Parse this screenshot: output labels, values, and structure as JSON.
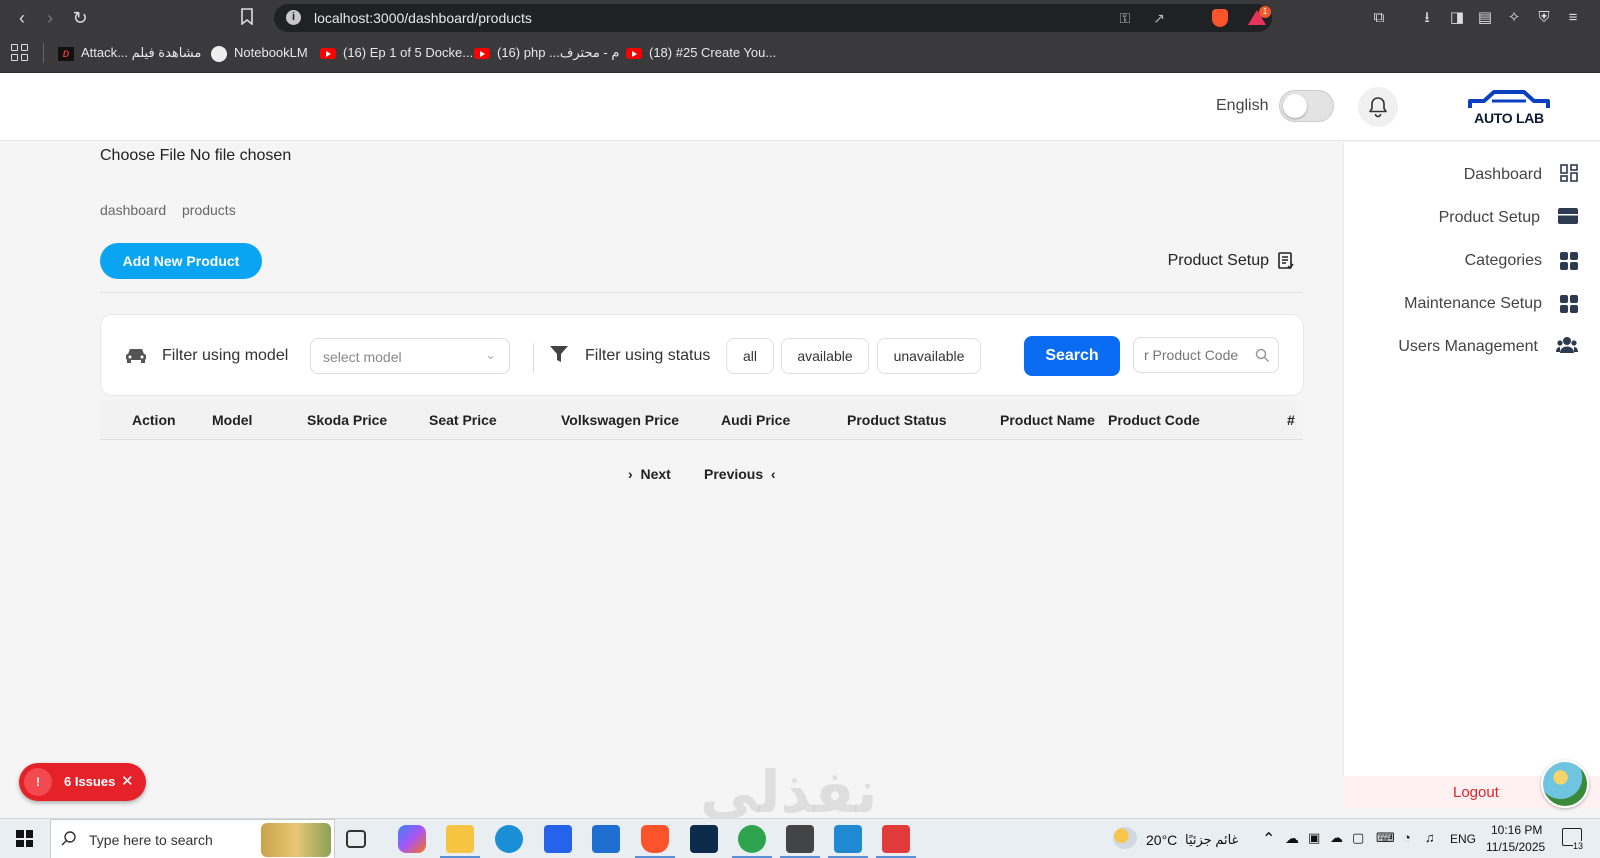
{
  "browser": {
    "url": "localhost:3000/dashboard/products",
    "bookmarks": [
      "Attack... مشاهدة فيلم",
      "NotebookLM",
      "(16) Ep 1 of 5 Docke...",
      "(16) php ...م - محترف",
      "(18) #25 Create You..."
    ],
    "extension_badge": "1"
  },
  "header": {
    "language_label": "English",
    "logo_text": "AUTO LAB"
  },
  "sidebar": {
    "items": [
      {
        "label": "Dashboard",
        "icon": "dashboard-icon"
      },
      {
        "label": "Product Setup",
        "icon": "box-icon"
      },
      {
        "label": "Categories",
        "icon": "grid-icon"
      },
      {
        "label": "Maintenance Setup",
        "icon": "grid-icon"
      },
      {
        "label": "Users Management",
        "icon": "users-icon"
      }
    ],
    "logout_label": "Logout"
  },
  "main": {
    "file_input_text": "Choose File No file chosen",
    "breadcrumb": [
      "dashboard",
      "products"
    ],
    "add_button_label": "Add New Product",
    "page_title": "Product Setup",
    "filter": {
      "model_label": "Filter using model",
      "model_placeholder": "select model",
      "status_label": "Filter using status",
      "status_options": [
        "all",
        "available",
        "unavailable"
      ],
      "search_label": "Search",
      "code_placeholder": "r Product Code"
    },
    "table_headers": [
      "Action",
      "Model",
      "Skoda Price",
      "Seat Price",
      "Volkswagen Price",
      "Audi Price",
      "Product Status",
      "Product Name",
      "Product Code",
      "#"
    ],
    "pagination": {
      "next_label": "Next",
      "previous_label": "Previous"
    }
  },
  "issues_badge": {
    "icon_text": "!",
    "label": "6 Issues"
  },
  "watermark": "نفذلي",
  "taskbar": {
    "search_placeholder": "Type here to search",
    "weather_temp": "20°C",
    "weather_text": "غائم جزئيًا",
    "language": "ENG",
    "time": "10:16 PM",
    "date": "11/15/2025",
    "notification_count": "13"
  },
  "colors": {
    "accent": "#0a6cf2",
    "add_button": "#0aa5f2",
    "logout": "#e0242c",
    "issues": "#e5222a"
  }
}
